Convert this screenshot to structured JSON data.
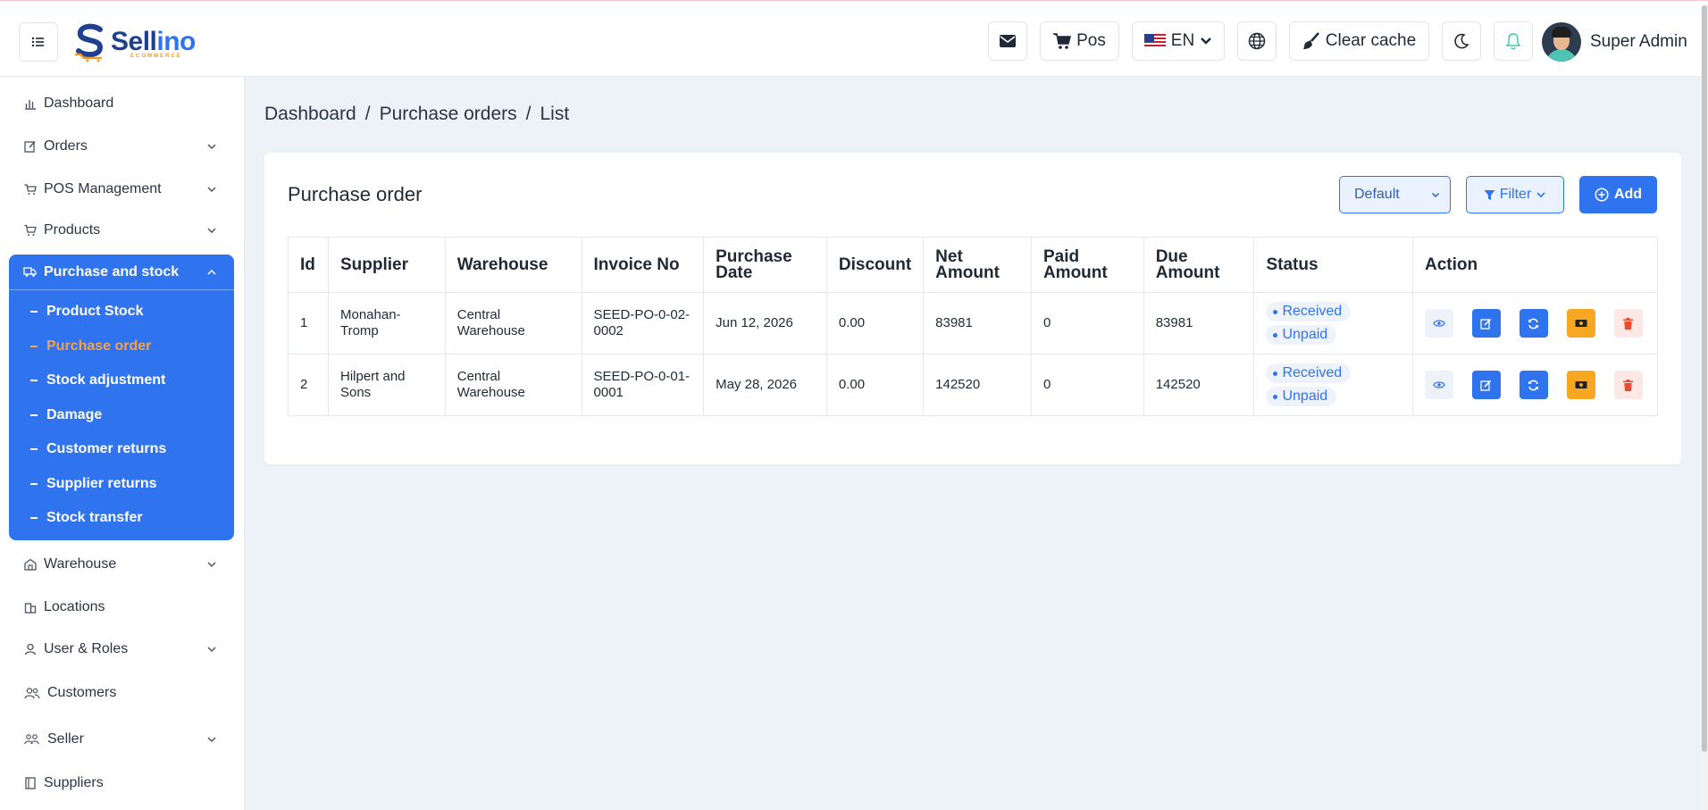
{
  "header": {
    "pos_label": "Pos",
    "language": "EN",
    "clear_cache_label": "Clear cache",
    "user_name": "Super Admin"
  },
  "logo": {
    "name_part1": "Sell",
    "name_part2": "ino",
    "sub": "ECOMMERCE"
  },
  "sidebar": {
    "items": [
      {
        "label": "Dashboard"
      },
      {
        "label": "Orders"
      },
      {
        "label": "POS Management"
      },
      {
        "label": "Products"
      },
      {
        "label": "Purchase and stock"
      },
      {
        "label": "Warehouse"
      },
      {
        "label": "Locations"
      },
      {
        "label": "User & Roles"
      },
      {
        "label": "Customers"
      },
      {
        "label": "Seller"
      },
      {
        "label": "Suppliers"
      }
    ],
    "sub_items": [
      {
        "label": "Product Stock"
      },
      {
        "label": "Purchase order"
      },
      {
        "label": "Stock adjustment"
      },
      {
        "label": "Damage"
      },
      {
        "label": "Customer returns"
      },
      {
        "label": "Supplier returns"
      },
      {
        "label": "Stock transfer"
      }
    ]
  },
  "breadcrumb": {
    "home": "Dashboard",
    "section": "Purchase orders",
    "current": "List"
  },
  "card": {
    "title": "Purchase order",
    "select_value": "Default",
    "filter_label": "Filter",
    "add_label": "Add"
  },
  "table": {
    "headers": [
      "Id",
      "Supplier",
      "Warehouse",
      "Invoice No",
      "Purchase Date",
      "Discount",
      "Net Amount",
      "Paid Amount",
      "Due Amount",
      "Status",
      "Action"
    ],
    "rows": [
      {
        "id": "1",
        "supplier": "Monahan-Tromp",
        "warehouse": "Central Warehouse",
        "invoice": "SEED-PO-0-02-0002",
        "date": "Jun 12, 2026",
        "discount": "0.00",
        "net": "83981",
        "paid": "0",
        "due": "83981",
        "status1": "Received",
        "status2": "Unpaid"
      },
      {
        "id": "2",
        "supplier": "Hilpert and Sons",
        "warehouse": "Central Warehouse",
        "invoice": "SEED-PO-0-01-0001",
        "date": "May 28, 2026",
        "discount": "0.00",
        "net": "142520",
        "paid": "0",
        "due": "142520",
        "status1": "Received",
        "status2": "Unpaid"
      }
    ]
  },
  "colors": {
    "primary": "#2f74ee",
    "accent": "#f5a04a",
    "warning": "#f7a721",
    "danger": "#ef4a2e"
  }
}
